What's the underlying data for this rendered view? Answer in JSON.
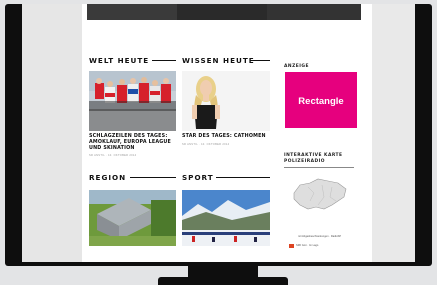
{
  "sections": {
    "welt": "WELT HEUTE",
    "wissen": "WISSEN HEUTE",
    "region": "REGION",
    "sport": "SPORT"
  },
  "articles": {
    "welt": {
      "headline": "SCHLAGZEILEN DES TAGES: AMOKLAUF, EUROPA LEAGUE UND SKINATION",
      "meta": "SR ANSTIL · 10. OKTOBER 2014"
    },
    "wissen": {
      "headline": "STAR DES TAGES: CATHOMEN",
      "meta": "SR ANSTIL · 10. OKTOBER 2014"
    }
  },
  "sidebar": {
    "ad_label": "ANZEIGE",
    "ad_text": "Rectangle",
    "map_title": "INTERAKTIVE KARTE POLIZEIRADIO",
    "map_caption": "mit Abgasbeschrankungen · RadioSP",
    "map_footer": "SRF Ismi · Im Lago"
  },
  "colors": {
    "ad_bg": "#e6007e",
    "bezel": "#0e0e0e"
  }
}
